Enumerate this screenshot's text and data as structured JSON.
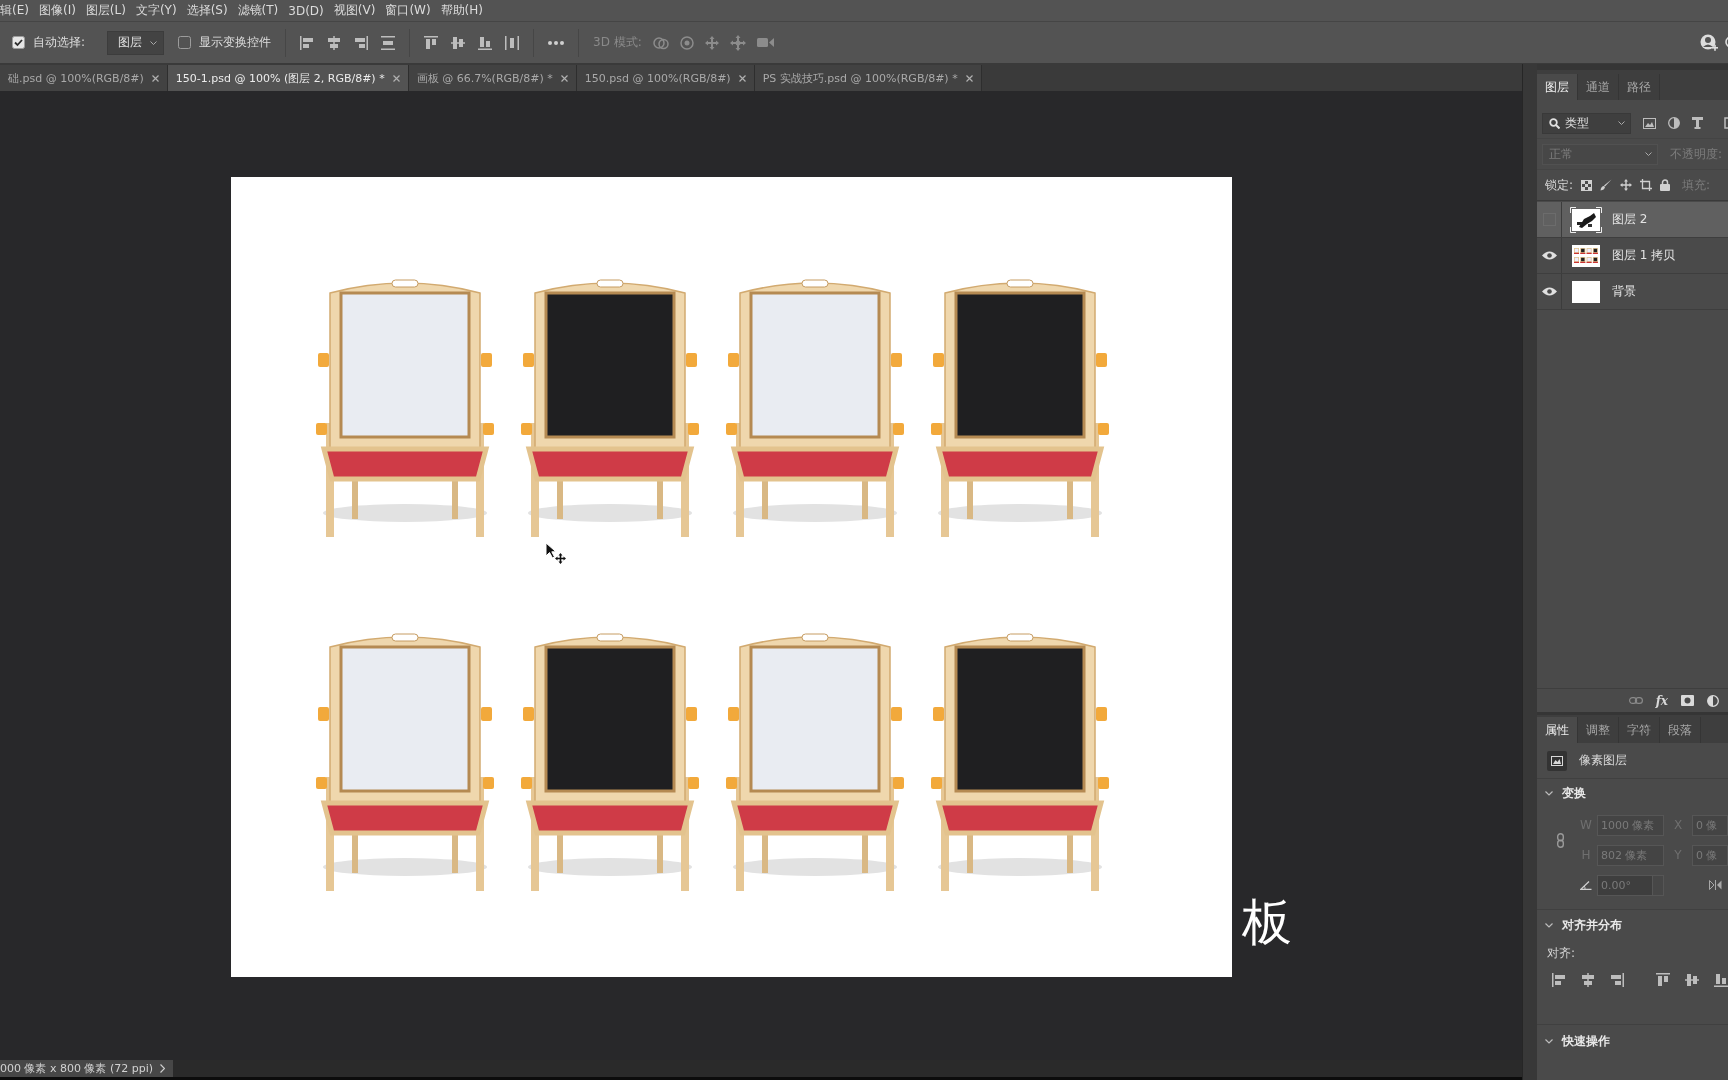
{
  "menu_bar": {
    "items": [
      "辑(E)",
      "图像(I)",
      "图层(L)",
      "文字(Y)",
      "选择(S)",
      "滤镜(T)",
      "3D(D)",
      "视图(V)",
      "窗口(W)",
      "帮助(H)"
    ]
  },
  "options_bar": {
    "auto_select": {
      "label": "自动选择:",
      "checked": true
    },
    "auto_select_target": {
      "value": "图层"
    },
    "transform_controls": {
      "label": "显示变换控件",
      "checked": false
    },
    "mode_3d_label": "3D 模式:"
  },
  "document_tabs": [
    {
      "title": "础.psd @ 100%(RGB/8#)",
      "selected": false
    },
    {
      "title": "150-1.psd @ 100% (图层 2, RGB/8#) *",
      "selected": true
    },
    {
      "title": "画板 @ 66.7%(RGB/8#) *",
      "selected": false
    },
    {
      "title": "150.psd @ 100%(RGB/8#)",
      "selected": false
    },
    {
      "title": "PS 实战技巧.psd @ 100%(RGB/8#) *",
      "selected": false
    }
  ],
  "canvas": {
    "caption": "板"
  },
  "status_bar": {
    "document_size": "000 像素 x 800 像素 (72 ppi)"
  },
  "layers_panel": {
    "tabs": [
      {
        "label": "图层",
        "selected": true
      },
      {
        "label": "通道",
        "selected": false
      },
      {
        "label": "路径",
        "selected": false
      }
    ],
    "filter": {
      "value": "类型"
    },
    "blend": {
      "mode": "正常",
      "opacity_label": "不透明度:",
      "disabled": true
    },
    "lock": {
      "label": "锁定:",
      "fill_label": "填充:",
      "fill_disabled": true
    },
    "layers": [
      {
        "name": "图层 2",
        "visible": false,
        "selected": true,
        "kind": "cutout"
      },
      {
        "name": "图层 1 拷贝",
        "visible": true,
        "selected": false,
        "kind": "grid"
      },
      {
        "name": "背景",
        "visible": true,
        "selected": false,
        "kind": "blank"
      }
    ],
    "effects_label": "fx"
  },
  "properties_panel": {
    "tabs": [
      {
        "label": "属性",
        "selected": true
      },
      {
        "label": "调整",
        "selected": false
      },
      {
        "label": "字符",
        "selected": false
      },
      {
        "label": "段落",
        "selected": false
      }
    ],
    "layer_type": "像素图层",
    "transform": {
      "title": "变换",
      "expanded": true,
      "disabled": true,
      "w_label": "W",
      "w": "1000 像素",
      "x_label": "X",
      "x": "0 像",
      "h_label": "H",
      "h": "802 像素",
      "y_label": "Y",
      "y": "0 像",
      "angle": "0.00°"
    },
    "align": {
      "title": "对齐并分布",
      "expanded": true,
      "label": "对齐:"
    },
    "quick_actions": {
      "title": "快速操作",
      "expanded": true
    }
  }
}
